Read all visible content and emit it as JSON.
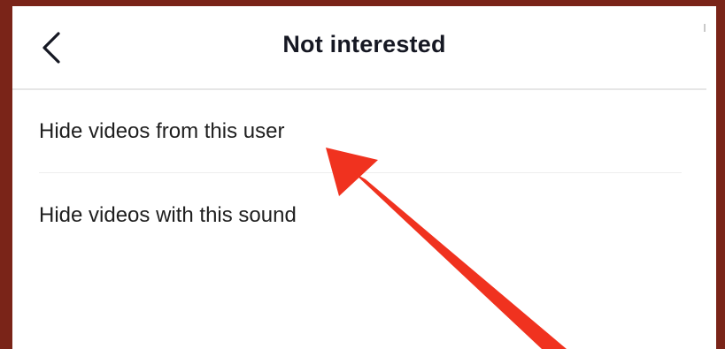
{
  "header": {
    "title": "Not interested",
    "back_icon": "chevron-left-icon"
  },
  "options": [
    {
      "label": "Hide videos from this user"
    },
    {
      "label": "Hide videos with this sound"
    }
  ],
  "annotation": {
    "arrow_color": "#f0321f",
    "arrow_icon": "red-arrow-pointer"
  },
  "colors": {
    "border": "#7a2418",
    "background": "#ffffff",
    "text": "#161823"
  }
}
